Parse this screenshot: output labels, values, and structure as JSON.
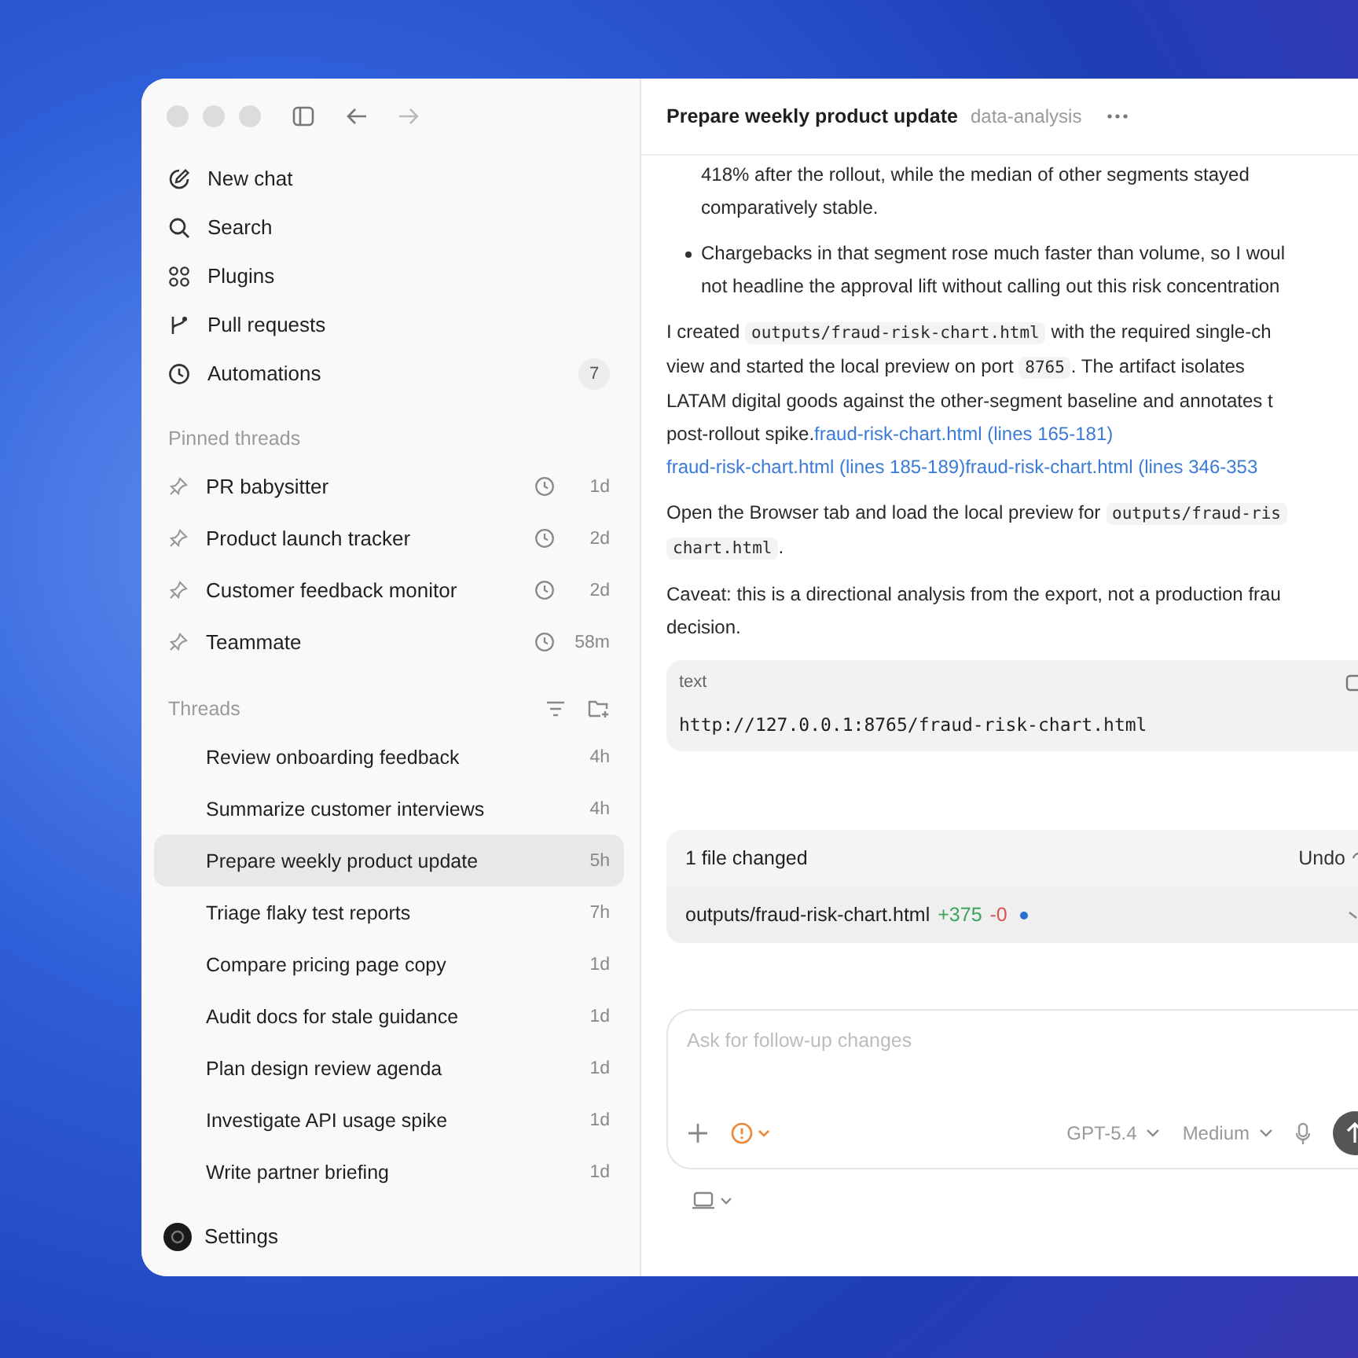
{
  "sidebar": {
    "nav": [
      {
        "label": "New chat"
      },
      {
        "label": "Search"
      },
      {
        "label": "Plugins"
      },
      {
        "label": "Pull requests"
      },
      {
        "label": "Automations",
        "badge": "7"
      }
    ],
    "pinned_header": "Pinned threads",
    "pinned": [
      {
        "label": "PR babysitter",
        "age": "1d"
      },
      {
        "label": "Product launch tracker",
        "age": "2d"
      },
      {
        "label": "Customer feedback monitor",
        "age": "2d"
      },
      {
        "label": "Teammate",
        "age": "58m"
      }
    ],
    "threads_header": "Threads",
    "threads": [
      {
        "label": "Review onboarding feedback",
        "age": "4h",
        "selected": false
      },
      {
        "label": "Summarize customer interviews",
        "age": "4h",
        "selected": false
      },
      {
        "label": "Prepare weekly product update",
        "age": "5h",
        "selected": true
      },
      {
        "label": "Triage flaky test reports",
        "age": "7h",
        "selected": false
      },
      {
        "label": "Compare pricing page copy",
        "age": "1d",
        "selected": false
      },
      {
        "label": "Audit docs for stale guidance",
        "age": "1d",
        "selected": false
      },
      {
        "label": "Plan design review agenda",
        "age": "1d",
        "selected": false
      },
      {
        "label": "Investigate API usage spike",
        "age": "1d",
        "selected": false
      },
      {
        "label": "Write partner briefing",
        "age": "1d",
        "selected": false
      }
    ],
    "settings": "Settings"
  },
  "header": {
    "title": "Prepare weekly product update",
    "tag": "data-analysis"
  },
  "bullets": [
    {
      "lines": [
        "418% after the rollout, while the median of other segments stayed",
        "comparatively stable."
      ],
      "marker": false
    },
    {
      "lines": [
        "Chargebacks in that segment rose much faster than volume, so I woul",
        "not headline the approval lift without calling out this risk concentration"
      ],
      "marker": true
    }
  ],
  "paragraphs": [
    {
      "lines": [
        [
          {
            "kind": "text",
            "text": "I created "
          },
          {
            "kind": "code",
            "text": "outputs/fraud-risk-chart.html"
          },
          {
            "kind": "text",
            "text": " with the required single-ch"
          }
        ],
        [
          {
            "kind": "text",
            "text": "view and started the local preview on port "
          },
          {
            "kind": "code",
            "text": "8765"
          },
          {
            "kind": "text",
            "text": ". The artifact isolates"
          }
        ],
        [
          {
            "kind": "text",
            "text": "LATAM digital goods against the other-segment baseline and annotates t"
          }
        ],
        [
          {
            "kind": "text",
            "text": "post-rollout spike."
          },
          {
            "kind": "link",
            "text": "fraud-risk-chart.html (lines 165-181)"
          }
        ],
        [
          {
            "kind": "link",
            "text": "fraud-risk-chart.html (lines 185-189)"
          },
          {
            "kind": "link",
            "text": "fraud-risk-chart.html (lines 346-353"
          }
        ]
      ]
    },
    {
      "lines": [
        [
          {
            "kind": "text",
            "text": "Open the Browser tab and load the local preview for "
          },
          {
            "kind": "code",
            "text": "outputs/fraud-ris"
          }
        ],
        [
          {
            "kind": "code",
            "text": "chart.html"
          },
          {
            "kind": "text",
            "text": "."
          }
        ]
      ]
    },
    {
      "lines": [
        [
          {
            "kind": "text",
            "text": "Caveat: this is a directional analysis from the export, not a production frau"
          }
        ],
        [
          {
            "kind": "text",
            "text": "decision."
          }
        ]
      ]
    }
  ],
  "code_block": {
    "language": "text",
    "code": "http://127.0.0.1:8765/fraud-risk-chart.html"
  },
  "changes": {
    "title": "1 file changed",
    "undo": "Undo",
    "file": "outputs/fraud-risk-chart.html",
    "added": "+375",
    "removed": "-0"
  },
  "composer": {
    "placeholder": "Ask for follow-up changes",
    "model": "GPT-5.4",
    "effort": "Medium"
  }
}
